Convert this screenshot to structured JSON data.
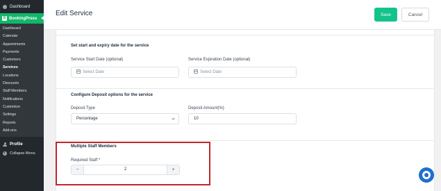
{
  "sidebar": {
    "dashboard_label": "Dashboard",
    "plugin_label": "BookingPress",
    "plugin_badge": "B",
    "items": [
      {
        "label": "Dashboard"
      },
      {
        "label": "Calendar"
      },
      {
        "label": "Appointments"
      },
      {
        "label": "Payments"
      },
      {
        "label": "Customers"
      },
      {
        "label": "Services",
        "active": true
      },
      {
        "label": "Locations"
      },
      {
        "label": "Discounts"
      },
      {
        "label": "Staff Members"
      },
      {
        "label": "Notifications"
      },
      {
        "label": "Customize"
      },
      {
        "label": "Settings"
      },
      {
        "label": "Reports"
      },
      {
        "label": "Add-ons"
      }
    ],
    "profile_label": "Profile",
    "collapse_label": "Collapse Menu"
  },
  "header": {
    "title": "Edit Service",
    "save_label": "Save",
    "cancel_label": "Cancel"
  },
  "dates_section": {
    "title": "Set start and expiry date for the service",
    "start_label": "Service Start Date (optional)",
    "start_placeholder": "Select Date",
    "expiry_label": "Service Expiration Date (optional)",
    "expiry_placeholder": "Select Date"
  },
  "deposit_section": {
    "title": "Configure Deposit options for the service",
    "type_label": "Deposit Type",
    "type_value": "Percentage",
    "amount_label": "Deposit Amount(%)",
    "amount_value": "10"
  },
  "staff_section": {
    "title": "Multiple Staff Members",
    "required_label": "Required Staff *",
    "minus": "−",
    "plus": "+",
    "value": "2"
  },
  "colors": {
    "accent": "#12c48b",
    "highlight_border": "#c0262d",
    "sidebar_bg": "#23282d",
    "help_button": "#1f6fd1"
  }
}
